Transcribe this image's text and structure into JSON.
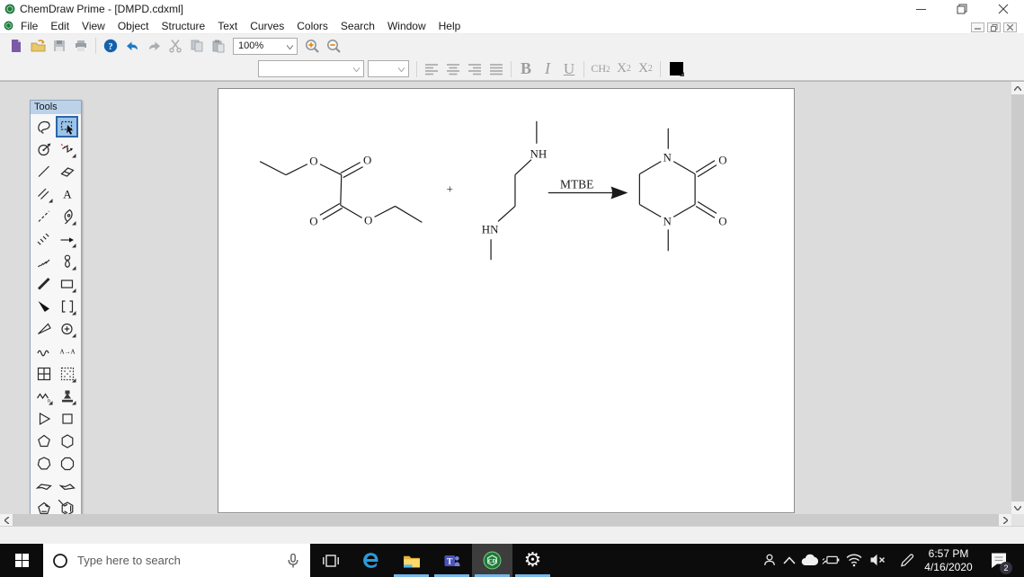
{
  "window": {
    "title": "ChemDraw Prime - [DMPD.cdxml]"
  },
  "menu": {
    "items": [
      "File",
      "Edit",
      "View",
      "Object",
      "Structure",
      "Text",
      "Curves",
      "Colors",
      "Search",
      "Window",
      "Help"
    ]
  },
  "toolbar": {
    "zoom_value": "100%"
  },
  "format_toolbar": {
    "bold": "B",
    "italic": "I",
    "underline": "U",
    "formula": {
      "main": "CH",
      "sub": "2"
    },
    "subscript": {
      "main": "X",
      "sub": "2"
    },
    "superscript": {
      "main": "X",
      "sup": "2"
    }
  },
  "tools_palette": {
    "title": "Tools",
    "tools": [
      {
        "name": "lasso-tool"
      },
      {
        "name": "marquee-tool",
        "selected": true
      },
      {
        "name": "rotate-tool"
      },
      {
        "name": "chain-tool",
        "flyout": true
      },
      {
        "name": "solid-bond-tool"
      },
      {
        "name": "eraser-tool"
      },
      {
        "name": "multiple-bond-tool",
        "flyout": true
      },
      {
        "name": "text-tool",
        "glyph": "A"
      },
      {
        "name": "dashed-bond-tool"
      },
      {
        "name": "pen-tool",
        "flyout": true
      },
      {
        "name": "hashed-bond-tool"
      },
      {
        "name": "arrow-tool",
        "flyout": true
      },
      {
        "name": "hashed-wedge-bond-tool"
      },
      {
        "name": "orbital-tool",
        "flyout": true
      },
      {
        "name": "bold-bond-tool"
      },
      {
        "name": "rectangle-tool",
        "flyout": true
      },
      {
        "name": "wedge-bond-tool"
      },
      {
        "name": "bracket-tool",
        "flyout": true
      },
      {
        "name": "hollow-wedge-bond-tool"
      },
      {
        "name": "charge-symbol-tool",
        "flyout": true
      },
      {
        "name": "wavy-bond-tool"
      },
      {
        "name": "atom-mapping-tool",
        "glyph": "A→A"
      },
      {
        "name": "table-tool"
      },
      {
        "name": "template-tool",
        "flyout": true
      },
      {
        "name": "polymer-tool",
        "flyout": true
      },
      {
        "name": "stamp-tool",
        "flyout": true
      },
      {
        "name": "cyclopropane-ring-tool"
      },
      {
        "name": "cyclobutane-ring-tool"
      },
      {
        "name": "cyclopentane-ring-tool"
      },
      {
        "name": "cyclohexane-ring-tool"
      },
      {
        "name": "cycloheptane-ring-tool"
      },
      {
        "name": "cyclooctane-ring-tool"
      },
      {
        "name": "chair-cyclohexane-tool"
      },
      {
        "name": "chair-cyclohexane-alt-tool"
      },
      {
        "name": "cyclopentadiene-ring-tool"
      },
      {
        "name": "benzene-ring-tool"
      }
    ]
  },
  "reaction": {
    "plus": "+",
    "arrow_label": "MTBE",
    "atom_labels": {
      "o": "O",
      "nh": "NH",
      "hn": "HN",
      "n": "N"
    }
  },
  "taskbar": {
    "search_placeholder": "Type here to search",
    "clock": {
      "time": "6:57 PM",
      "date": "4/16/2020"
    },
    "notification_count": "2"
  }
}
